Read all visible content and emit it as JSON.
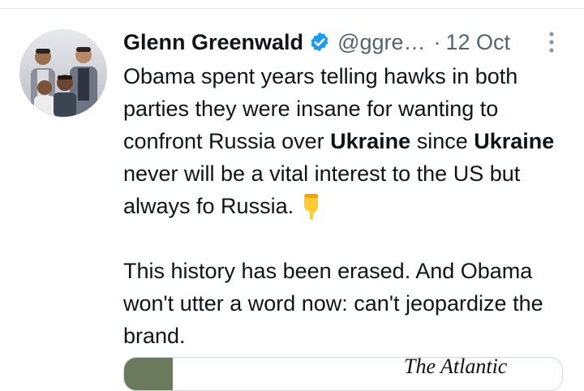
{
  "tweet": {
    "author_name": "Glenn Greenwald",
    "handle": "@ggre…",
    "separator": "·",
    "date": "12 Oct",
    "icons": {
      "verified": "verified-badge-icon",
      "more": "more-options-icon",
      "emoji": "pointing-down-emoji"
    },
    "text": {
      "p1_part1": "Obama spent years telling hawks in both parties they were insane for wanting to confront Russia over ",
      "p1_bold1": "Ukraine",
      "p1_part2": " since ",
      "p1_bold2": "Ukraine",
      "p1_part3": " never will be a vital interest to the US but always fo Russia.",
      "p2": "This history has been erased. And Obama won't utter a word now: can't jeopardize the brand."
    },
    "card": {
      "title": "The Atlantic"
    },
    "colors": {
      "text": "#0f1419",
      "secondary": "#536471",
      "verified": "#1d9bf0",
      "border": "#cfd9de"
    }
  }
}
